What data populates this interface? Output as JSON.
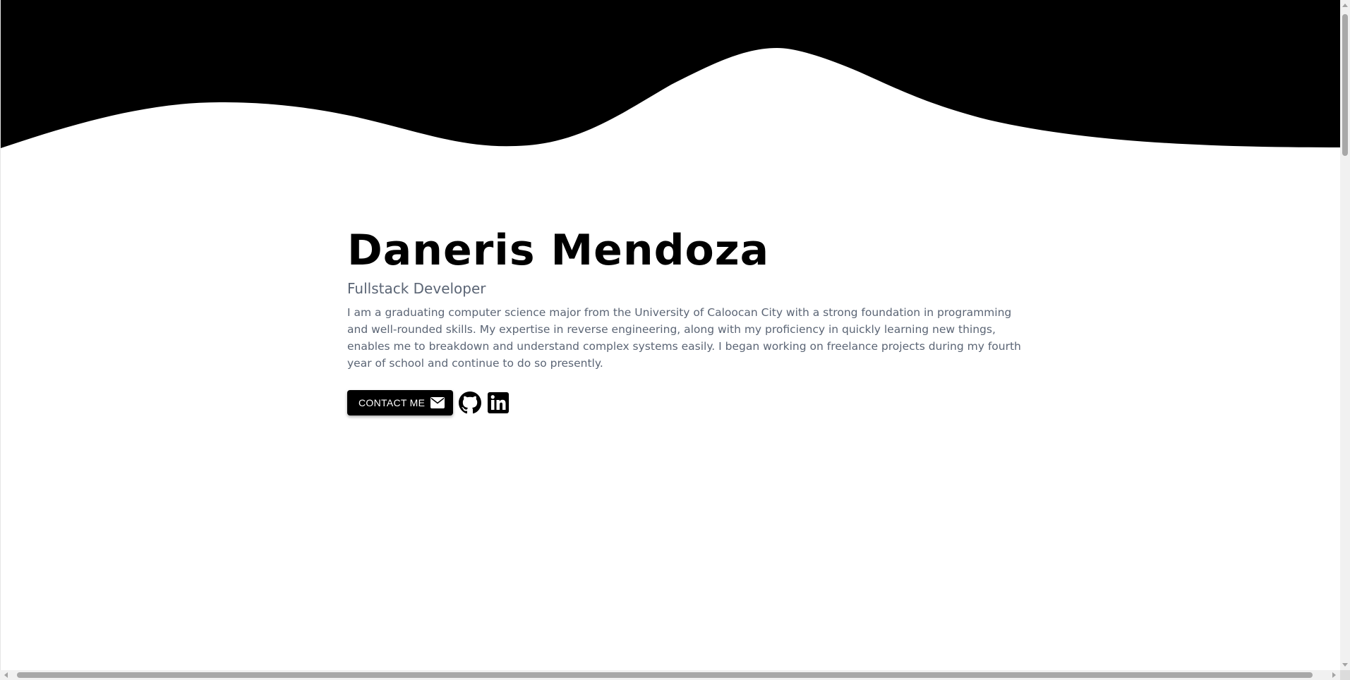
{
  "hero": {
    "name": "Daneris Mendoza",
    "role": "Fullstack Developer",
    "bio": "I am a graduating computer science major from the University of Caloocan City with a strong foundation in programming and well-rounded skills. My expertise in reverse engineering, along with my proficiency in quickly learning new things, enables me to breakdown and understand complex systems easily. I began working on freelance projects during my fourth year of school and continue to do so presently."
  },
  "actions": {
    "contact_label": "CONTACT ME",
    "contact_icon": "envelope-icon",
    "social": [
      {
        "name": "github-icon"
      },
      {
        "name": "linkedin-icon"
      }
    ]
  },
  "colors": {
    "background": "#ffffff",
    "wave": "#000000",
    "heading": "#000000",
    "muted_text": "#5b6575",
    "button_bg": "#000000",
    "button_text": "#ffffff"
  }
}
